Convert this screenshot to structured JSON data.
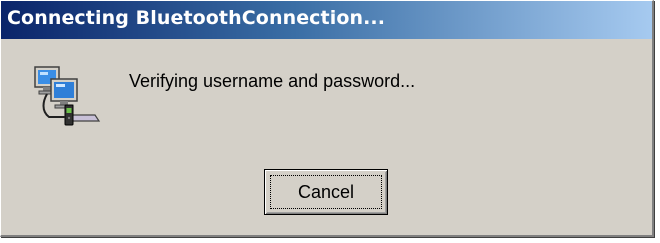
{
  "window": {
    "title": "Connecting BluetoothConnection...",
    "titlebar_gradient": [
      "#0a246a",
      "#3a6ea5",
      "#a6caf0"
    ],
    "face_color": "#d4d0c8"
  },
  "content": {
    "icon": "network-connection-icon",
    "message": "Verifying username and password..."
  },
  "buttons": {
    "cancel_label": "Cancel"
  }
}
